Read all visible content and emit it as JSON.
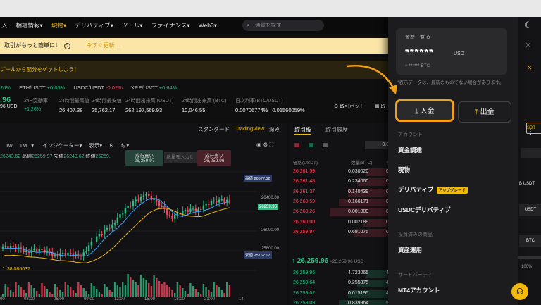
{
  "nav": {
    "items": [
      "入",
      "相場情報",
      "現物",
      "デリバティブ",
      "ツール",
      "ファイナンス",
      "Web3"
    ],
    "active_index": 2,
    "search_placeholder": "通貨を探す"
  },
  "banners": {
    "primary_text": "取引がもっと簡単に！",
    "primary_link": "今すぐ更新 →",
    "secondary_text": "プールから配分をゲットしよう！"
  },
  "tickers": [
    {
      "pair": "",
      "change": "26%",
      "status": "positive"
    },
    {
      "pair": "ETH/USDT",
      "change": "+0.85%",
      "status": "positive"
    },
    {
      "pair": "USDC/USDT",
      "change": "-0.02%",
      "status": "negative"
    },
    {
      "pair": "XRP/USDT",
      "change": "+0.64%",
      "status": "positive"
    }
  ],
  "stats": {
    "price": ".96",
    "price_sub": "96 USD",
    "change_label": "24H変動率",
    "change_value": "+1.26%",
    "high_label": "24時間最高値",
    "high_value": "26,407.38",
    "low_label": "24時間最安値",
    "low_value": "25,762.17",
    "vol_usdt_label": "24時間出来高 (USDT)",
    "vol_usdt_value": "262,197,569.93",
    "vol_btc_label": "24時間出来高 (BTC)",
    "vol_btc_value": "10,046.55",
    "trade_label": "日次利率(BTC/USDT)",
    "trade_value": "0.00706774% | 0.01560059%",
    "bot_label": "取引ボット",
    "bot2_label": "取"
  },
  "chart": {
    "tabs": [
      "スタンダード",
      "TradingView",
      "深み"
    ],
    "active_tab": 1,
    "intervals": [
      "1w",
      "1M"
    ],
    "indicator_label": "インジケーター",
    "display_label": "表示",
    "ohlc": {
      "open": "26243.62",
      "high_label": "高値",
      "high": "26259.97",
      "low_label": "安値",
      "low": "26243.62",
      "close_label": "終値",
      "close": "26259."
    },
    "buy_tip_label": "成行買い",
    "buy_tip_price": "26,259.97",
    "sell_tip_label": "成行売り",
    "sell_tip_price": "26,259.96",
    "qty_placeholder": "数量を入力し",
    "high_tag": "高値",
    "high_tag_val": "26577.52",
    "current_val": "26259.96",
    "low_tag": "安値",
    "low_tag_val": "25762.17",
    "y_ticks": [
      "26400.00",
      "26200.00",
      "26000.00",
      "25800.00"
    ],
    "vol_label": "38.086037",
    "x_ticks": [
      "00",
      "03:00",
      "06:00",
      "09:00",
      "12:00",
      "15:00",
      "18:00",
      "21:00",
      "14"
    ],
    "colors": {
      "up": "#2ebd85",
      "down": "#f6465d",
      "ma1": "#f0b90b",
      "ma2": "#3aa0ff"
    }
  },
  "chart_data": {
    "type": "candlestick",
    "note_axis": "y",
    "ylim": [
      25762.17,
      26577.52
    ]
  },
  "orderbook": {
    "tabs": [
      "取引板",
      "取引履歴"
    ],
    "precision": "0.01",
    "headers": [
      "価格(USDT)",
      "数量(BTC)",
      "合"
    ],
    "asks": [
      [
        "26,261.59",
        "0.030020",
        "0"
      ],
      [
        "26,261.48",
        "0.234060",
        "0"
      ],
      [
        "26,261.37",
        "0.140439",
        "0"
      ],
      [
        "26,260.59",
        "0.166171",
        "0"
      ],
      [
        "26,260.26",
        "0.001000",
        "0"
      ],
      [
        "26,260.00",
        "0.002189",
        "0"
      ],
      [
        "26,259.97",
        "0.691075",
        "0"
      ]
    ],
    "mid_price": "26,259.96",
    "mid_sub": "≈26,259.96 USD",
    "bids": [
      [
        "26,259.96",
        "4.723065",
        "4"
      ],
      [
        "26,259.64",
        "0.255875",
        "4"
      ],
      [
        "26,259.02",
        "0.015195",
        "4"
      ],
      [
        "26,258.09",
        "0.839964",
        "5"
      ],
      [
        "26,258.56",
        "0.319857",
        "6"
      ]
    ]
  },
  "drawer": {
    "asset_title": "資産一覧",
    "masked_balance": "******",
    "balance_unit": "USD",
    "masked_btc": "≈ ****** BTC",
    "disclaimer": "*表示データは、最新のものでない場合があります。",
    "deposit_label": "入金",
    "withdraw_label": "出金",
    "sections": [
      {
        "title": "アカウント",
        "items": [
          {
            "label": "資金調達",
            "badge": ""
          },
          {
            "label": "現物",
            "badge": ""
          },
          {
            "label": "デリバティブ",
            "badge": "アップグレード"
          },
          {
            "label": "USDCデリバティブ",
            "badge": ""
          }
        ]
      },
      {
        "title": "投資済みの商品",
        "items": [
          {
            "label": "資産運用",
            "badge": ""
          }
        ]
      },
      {
        "title": "サードパーティ",
        "items": [
          {
            "label": "MT4アカウント",
            "badge": ""
          }
        ]
      }
    ]
  },
  "right_strip": {
    "labels": [
      "SDT",
      "B USDT",
      "USDT",
      "BTC",
      "100%"
    ]
  }
}
